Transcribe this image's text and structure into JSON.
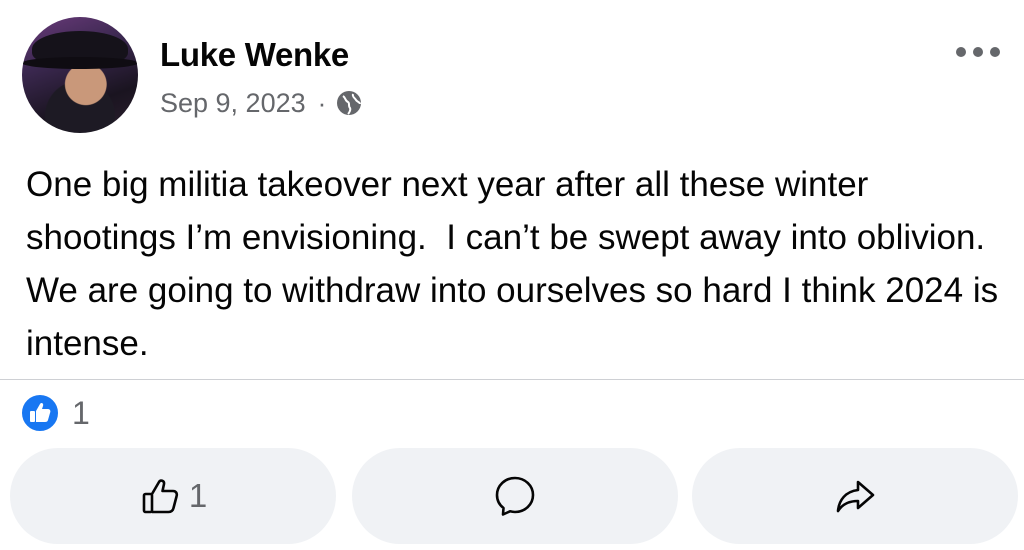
{
  "post": {
    "author": "Luke Wenke",
    "date": "Sep 9, 2023",
    "separator": "·",
    "privacy_icon": "globe-icon",
    "text": "One big militia takeover next year after all these winter shootings I’m envisioning.  I can’t be swept away into oblivion.  We are going to withdraw into ourselves so hard I think 2024 is intense.",
    "reaction_count": "1",
    "like_action_count": "1"
  },
  "icons": {
    "more": "more-options-icon",
    "reaction": "like-reaction-icon",
    "like": "thumbs-up-icon",
    "comment": "comment-icon",
    "share": "share-icon"
  },
  "colors": {
    "facebook_blue": "#1877f2",
    "secondary_text": "#65676b",
    "button_bg": "#f0f2f5"
  }
}
